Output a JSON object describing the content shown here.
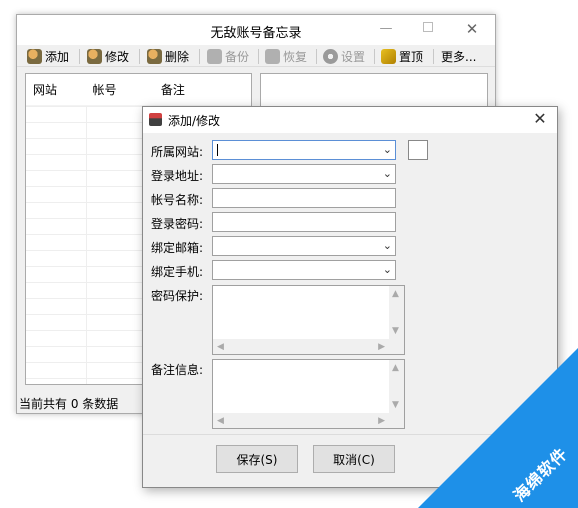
{
  "main_window": {
    "title": "无敌账号备忘录",
    "toolbar": {
      "add": "添加",
      "edit": "修改",
      "delete": "删除",
      "backup": "备份",
      "restore": "恢复",
      "settings": "设置",
      "pin": "置顶",
      "more": "更多..."
    },
    "list": {
      "columns": [
        "网站",
        "帐号",
        "备注"
      ]
    },
    "status": "当前共有 0 条数据"
  },
  "dialog": {
    "title": "添加/修改",
    "fields": [
      {
        "label": "所属网站:",
        "value": ""
      },
      {
        "label": "登录地址:",
        "value": ""
      },
      {
        "label": "帐号名称:",
        "value": ""
      },
      {
        "label": "登录密码:",
        "value": ""
      },
      {
        "label": "绑定邮箱:",
        "value": ""
      },
      {
        "label": "绑定手机:",
        "value": ""
      }
    ],
    "password_protect_label": "密码保护:",
    "notes_label": "备注信息:",
    "save_button": "保存(S)",
    "cancel_button": "取消(C)"
  },
  "watermark": {
    "text": "海绵软件",
    "color": "#1e90e8"
  },
  "icons": {
    "dropdown": "chevron-down-icon",
    "close": "close-icon"
  }
}
